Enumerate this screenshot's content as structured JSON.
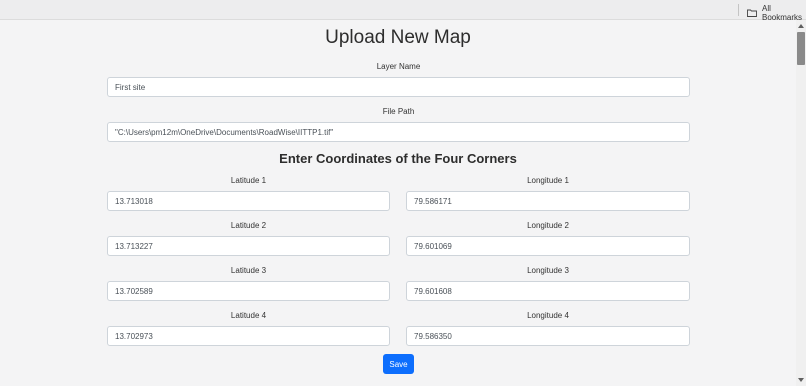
{
  "bookmarks": {
    "all_label": "All Bookmarks",
    "folder_icon": "folder-icon"
  },
  "page": {
    "title": "Upload New Map",
    "layer_name": {
      "label": "Layer Name",
      "value": "First site"
    },
    "file_path": {
      "label": "File Path",
      "value": "\"C:\\Users\\pm12m\\OneDrive\\Documents\\RoadWise\\IITTP1.tif\""
    },
    "coords_heading": "Enter Coordinates of the Four Corners",
    "latitudes": [
      {
        "label": "Latitude 1",
        "value": "13.713018"
      },
      {
        "label": "Latitude 2",
        "value": "13.713227"
      },
      {
        "label": "Latitude 3",
        "value": "13.702589"
      },
      {
        "label": "Latitude 4",
        "value": "13.702973"
      }
    ],
    "longitudes": [
      {
        "label": "Longitude 1",
        "value": "79.586171"
      },
      {
        "label": "Longitude 2",
        "value": "79.601069"
      },
      {
        "label": "Longitude 3",
        "value": "79.601608"
      },
      {
        "label": "Longitude 4",
        "value": "79.586350"
      }
    ],
    "save_label": "Save",
    "accent_color": "#0d6efd"
  }
}
